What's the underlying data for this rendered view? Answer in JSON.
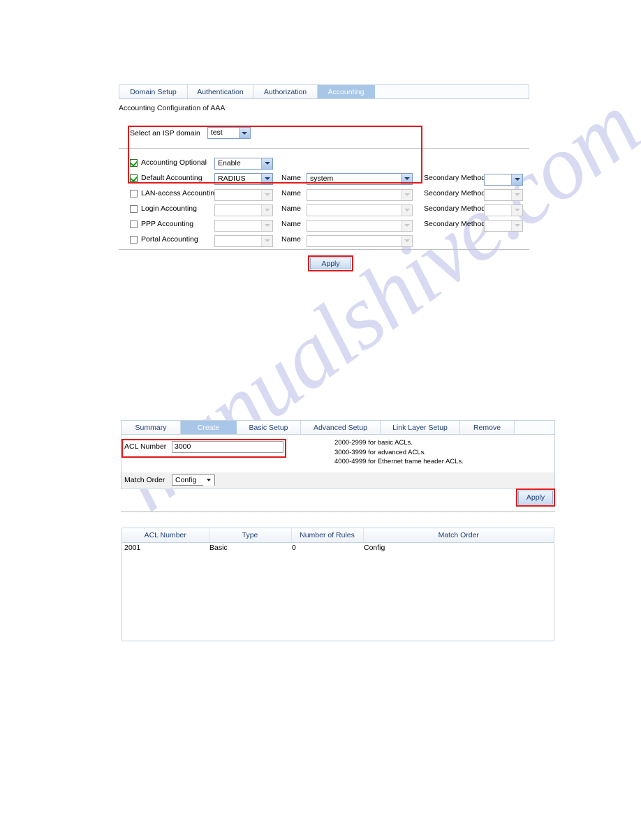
{
  "watermark": {
    "text": "manualshive.com"
  },
  "aaa": {
    "tabs": [
      {
        "label": "Domain Setup",
        "active": false
      },
      {
        "label": "Authentication",
        "active": false
      },
      {
        "label": "Authorization",
        "active": false
      },
      {
        "label": "Accounting",
        "active": true
      }
    ],
    "caption": "Accounting Configuration of AAA",
    "isp": {
      "label": "Select an ISP domain",
      "value": "test"
    },
    "name_label": "Name",
    "secondary_label": "Secondary Method",
    "rows": [
      {
        "label": "Accounting Optional",
        "checked": true,
        "method": "Enable",
        "method_enabled": true,
        "has_name": false,
        "name": "",
        "name_enabled": false,
        "has_secondary": false,
        "secondary": "",
        "secondary_enabled": false
      },
      {
        "label": "Default Accounting",
        "checked": true,
        "method": "RADIUS",
        "method_enabled": true,
        "has_name": true,
        "name": "system",
        "name_enabled": true,
        "has_secondary": true,
        "secondary": "",
        "secondary_enabled": true
      },
      {
        "label": "LAN-access Accounting",
        "checked": false,
        "method": "",
        "method_enabled": false,
        "has_name": true,
        "name": "",
        "name_enabled": false,
        "has_secondary": true,
        "secondary": "",
        "secondary_enabled": false
      },
      {
        "label": "Login Accounting",
        "checked": false,
        "method": "",
        "method_enabled": false,
        "has_name": true,
        "name": "",
        "name_enabled": false,
        "has_secondary": true,
        "secondary": "",
        "secondary_enabled": false
      },
      {
        "label": "PPP Accounting",
        "checked": false,
        "method": "",
        "method_enabled": false,
        "has_name": true,
        "name": "",
        "name_enabled": false,
        "has_secondary": true,
        "secondary": "",
        "secondary_enabled": false
      },
      {
        "label": "Portal Accounting",
        "checked": false,
        "method": "",
        "method_enabled": false,
        "has_name": true,
        "name": "",
        "name_enabled": false,
        "has_secondary": false,
        "secondary": "",
        "secondary_enabled": false
      }
    ],
    "apply_label": "Apply"
  },
  "acl": {
    "tabs": [
      {
        "label": "Summary",
        "active": false
      },
      {
        "label": "Create",
        "active": true
      },
      {
        "label": "Basic Setup",
        "active": false
      },
      {
        "label": "Advanced Setup",
        "active": false
      },
      {
        "label": "Link Layer Setup",
        "active": false
      },
      {
        "label": "Remove",
        "active": false
      }
    ],
    "acl_number_label": "ACL Number",
    "acl_number_value": "3000",
    "hint_lines": [
      "2000-2999 for basic ACLs.",
      "3000-3999 for advanced ACLs.",
      "4000-4999 for Ethernet frame header ACLs."
    ],
    "match_order_label": "Match Order",
    "match_order_value": "Config",
    "apply_label": "Apply",
    "table": {
      "columns": [
        "ACL Number",
        "Type",
        "Number of Rules",
        "Match Order"
      ],
      "rows": [
        [
          "2001",
          "Basic",
          "0",
          "Config"
        ]
      ]
    }
  },
  "colors": {
    "highlight_red": "#e01b1b",
    "active_tab_blue": "#a8c6e8",
    "tab_text_blue": "#1f3f73",
    "watermark": "#b9bde8"
  }
}
